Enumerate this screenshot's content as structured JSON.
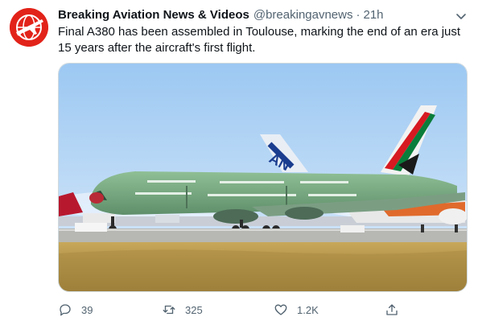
{
  "tweet": {
    "author_name": "Breaking Aviation News & Videos",
    "handle": "@breakingavnews",
    "separator": "·",
    "time": "21h",
    "text": "Final A380 has been assembled in Toulouse, marking the end of an era just 15 years after the aircraft's first flight."
  },
  "avatar": {
    "icon": "airplane-globe-logo",
    "color": "#e2231a"
  },
  "media": {
    "description_icon": "aircraft-photo"
  },
  "actions": {
    "replies": "39",
    "retweets": "325",
    "likes": "1.2K"
  },
  "icons": {
    "reply": "reply-icon",
    "retweet": "retweet-icon",
    "like": "heart-icon",
    "share": "share-icon",
    "more": "chevron-down-icon"
  },
  "colors": {
    "text": "#0f1419",
    "secondary": "#536471",
    "brand_red": "#e2231a"
  }
}
